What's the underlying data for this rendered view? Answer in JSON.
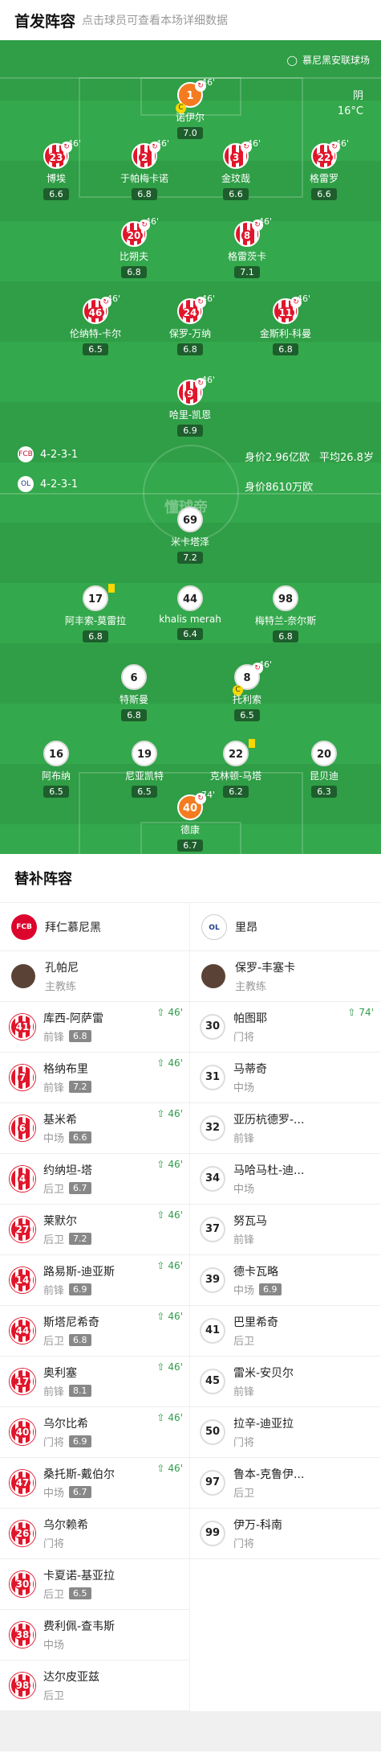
{
  "header": {
    "title": "首发阵容",
    "hint": "点击球员可查看本场详细数据"
  },
  "stadium": "慕尼黑安联球场",
  "weather": {
    "condition": "阴",
    "temp": "16°C"
  },
  "watermark": "懂球帝",
  "home": {
    "formation": "4-2-3-1",
    "value": "身价2.96亿欧",
    "age": "平均26.8岁"
  },
  "away": {
    "formation": "4-2-3-1",
    "value": "身价8610万欧"
  },
  "home_players": [
    {
      "num": "1",
      "name": "诺伊尔",
      "rating": "7.0",
      "sub": "46'"
    },
    {
      "num": "23",
      "name": "博埃",
      "rating": "6.6",
      "sub": "46'"
    },
    {
      "num": "2",
      "name": "于帕梅卡诺",
      "rating": "6.8",
      "sub": "46'"
    },
    {
      "num": "3",
      "name": "金玟哉",
      "rating": "6.6",
      "sub": "46'"
    },
    {
      "num": "22",
      "name": "格雷罗",
      "rating": "6.6",
      "sub": "46'"
    },
    {
      "num": "20",
      "name": "比朔夫",
      "rating": "6.8",
      "sub": "46'"
    },
    {
      "num": "8",
      "name": "格雷茨卡",
      "rating": "7.1",
      "sub": "46'"
    },
    {
      "num": "46",
      "name": "伦纳特-卡尔",
      "rating": "6.5",
      "sub": "46'"
    },
    {
      "num": "24",
      "name": "保罗-万纳",
      "rating": "6.8",
      "sub": "46'"
    },
    {
      "num": "11",
      "name": "金斯利-科曼",
      "rating": "6.8",
      "sub": "46'"
    },
    {
      "num": "9",
      "name": "哈里-凯恩",
      "rating": "6.9",
      "sub": "46'"
    }
  ],
  "away_players": [
    {
      "num": "69",
      "name": "米卡塔泽",
      "rating": "7.2"
    },
    {
      "num": "17",
      "name": "阿丰索-莫雷拉",
      "rating": "6.8"
    },
    {
      "num": "44",
      "name": "khalis merah",
      "rating": "6.4"
    },
    {
      "num": "98",
      "name": "梅特兰-奈尔斯",
      "rating": "6.8"
    },
    {
      "num": "6",
      "name": "特斯曼",
      "rating": "6.8"
    },
    {
      "num": "8",
      "name": "托利索",
      "rating": "6.5",
      "sub": "46'"
    },
    {
      "num": "16",
      "name": "阿布纳",
      "rating": "6.5"
    },
    {
      "num": "19",
      "name": "尼亚凯特",
      "rating": "6.5"
    },
    {
      "num": "22",
      "name": "克林顿-马塔",
      "rating": "6.2"
    },
    {
      "num": "20",
      "name": "昆贝迪",
      "rating": "6.3"
    },
    {
      "num": "40",
      "name": "德康",
      "rating": "6.7",
      "sub": "74'"
    }
  ],
  "subs_title": "替补阵容",
  "home_team": "拜仁慕尼黑",
  "away_team": "里昂",
  "home_logo": "FCB",
  "away_logo": "OL",
  "home_coach": {
    "name": "孔帕尼",
    "role": "主教练"
  },
  "away_coach": {
    "name": "保罗-丰塞卡",
    "role": "主教练"
  },
  "home_subs": [
    {
      "num": "41",
      "name": "库西-阿萨雷",
      "pos": "前锋",
      "score": "6.8",
      "mark": "46'"
    },
    {
      "num": "7",
      "name": "格纳布里",
      "pos": "前锋",
      "score": "7.2",
      "mark": "46'"
    },
    {
      "num": "6",
      "name": "基米希",
      "pos": "中场",
      "score": "6.6",
      "mark": "46'"
    },
    {
      "num": "4",
      "name": "约纳坦-塔",
      "pos": "后卫",
      "score": "6.7",
      "mark": "46'"
    },
    {
      "num": "27",
      "name": "莱默尔",
      "pos": "后卫",
      "score": "7.2",
      "mark": "46'"
    },
    {
      "num": "14",
      "name": "路易斯-迪亚斯",
      "pos": "前锋",
      "score": "6.9",
      "mark": "46'"
    },
    {
      "num": "44",
      "name": "斯塔尼希奇",
      "pos": "后卫",
      "score": "6.8",
      "mark": "46'"
    },
    {
      "num": "17",
      "name": "奥利塞",
      "pos": "前锋",
      "score": "8.1",
      "mark": "46'"
    },
    {
      "num": "40",
      "name": "乌尔比希",
      "pos": "门将",
      "score": "6.9",
      "mark": "46'"
    },
    {
      "num": "47",
      "name": "桑托斯-戴伯尔",
      "pos": "中场",
      "score": "6.7",
      "mark": "46'"
    },
    {
      "num": "26",
      "name": "乌尔赖希",
      "pos": "门将",
      "score": "",
      "mark": ""
    },
    {
      "num": "30",
      "name": "卡夏诺-基亚拉",
      "pos": "后卫",
      "score": "6.5",
      "mark": ""
    },
    {
      "num": "38",
      "name": "费利佩-查韦斯",
      "pos": "中场",
      "score": "",
      "mark": ""
    },
    {
      "num": "98",
      "name": "达尔皮亚兹",
      "pos": "后卫",
      "score": "",
      "mark": ""
    }
  ],
  "away_subs": [
    {
      "num": "30",
      "name": "帕图耶",
      "pos": "门将",
      "score": "",
      "mark": "74'"
    },
    {
      "num": "31",
      "name": "马蒂奇",
      "pos": "中场",
      "score": "",
      "mark": ""
    },
    {
      "num": "32",
      "name": "亚历杭德罗-...",
      "pos": "前锋",
      "score": "",
      "mark": ""
    },
    {
      "num": "34",
      "name": "马哈马杜-迪...",
      "pos": "中场",
      "score": "",
      "mark": ""
    },
    {
      "num": "37",
      "name": "努瓦马",
      "pos": "前锋",
      "score": "",
      "mark": ""
    },
    {
      "num": "39",
      "name": "德卡瓦略",
      "pos": "中场",
      "score": "6.9",
      "mark": ""
    },
    {
      "num": "41",
      "name": "巴里希奇",
      "pos": "后卫",
      "score": "",
      "mark": ""
    },
    {
      "num": "45",
      "name": "雷米-安贝尔",
      "pos": "前锋",
      "score": "",
      "mark": ""
    },
    {
      "num": "50",
      "name": "拉辛-迪亚拉",
      "pos": "门将",
      "score": "",
      "mark": ""
    },
    {
      "num": "97",
      "name": "鲁本-克鲁伊...",
      "pos": "后卫",
      "score": "",
      "mark": ""
    },
    {
      "num": "99",
      "name": "伊万-科南",
      "pos": "门将",
      "score": "",
      "mark": ""
    }
  ]
}
